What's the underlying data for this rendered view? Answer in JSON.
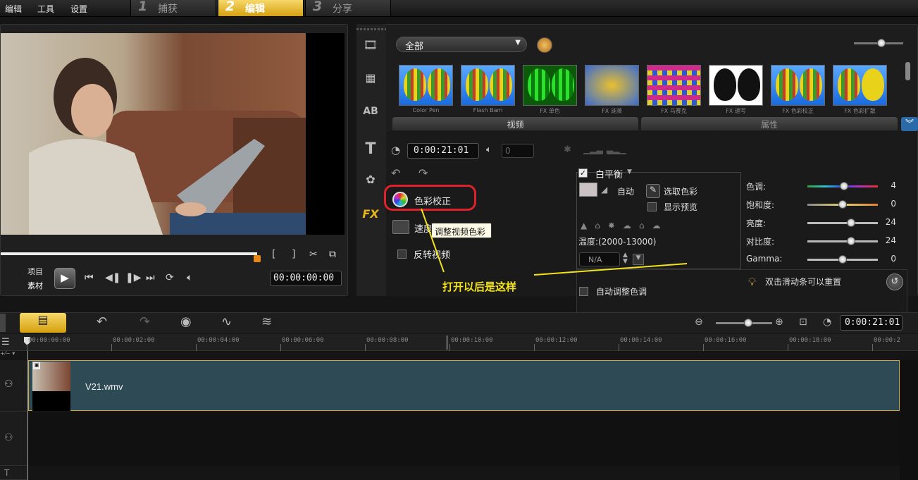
{
  "menu": {
    "items": [
      "编辑",
      "工具",
      "设置"
    ]
  },
  "steps": [
    {
      "num": "1",
      "label": "捕获"
    },
    {
      "num": "2",
      "label": "编辑"
    },
    {
      "num": "3",
      "label": "分享"
    }
  ],
  "player": {
    "mode_project": "项目",
    "mode_clip": "素材",
    "timecode": "00:00:00:00"
  },
  "library": {
    "dropdown": "全部",
    "thumbnails": [
      "Color Pen",
      "Flash Bam",
      "FX 单色",
      "FX 涟漪",
      "FX 马赛克",
      "FX 速写",
      "FX 色彩校正",
      "FX 色彩扩散"
    ],
    "tab_video": "视频",
    "tab_attr": "属性"
  },
  "options": {
    "duration": "0:00:21:01",
    "volume": "0",
    "color_correction": "色彩校正",
    "tooltip": "调整视频色彩",
    "speed": "速度",
    "reverse": "反转视频"
  },
  "white_balance": {
    "label": "白平衡",
    "auto": "自动",
    "pick_color": "选取色彩",
    "show_preview": "显示预览",
    "temperature": "温度:(2000-13000)",
    "temp_value": "N/A",
    "auto_tone": "自动调整色调"
  },
  "adjust": {
    "rows": [
      {
        "label": "色调:",
        "value": "4",
        "pct": 0.52
      },
      {
        "label": "饱和度:",
        "value": "0",
        "pct": 0.5
      },
      {
        "label": "亮度:",
        "value": "24",
        "pct": 0.62
      },
      {
        "label": "对比度:",
        "value": "24",
        "pct": 0.62
      },
      {
        "label": "Gamma:",
        "value": "0",
        "pct": 0.5
      }
    ],
    "reset_hint": "双击滑动条可以重置"
  },
  "annotation": "打开以后是这样",
  "timeline": {
    "duration": "0:00:21:01",
    "ticks": [
      "00:00:00:00",
      "00:00:02:00",
      "00:00:04:00",
      "00:00:06:00",
      "00:00:08:00",
      "00:00:10:00",
      "00:00:12:00",
      "00:00:14:00",
      "00:00:16:00",
      "00:00:18:00",
      "00:00:2"
    ],
    "clip_name": "V21.wmv"
  },
  "colors": {
    "accent": "#e8b51c",
    "highlight_ring": "#e0202a",
    "annotation": "#f2e21a"
  }
}
